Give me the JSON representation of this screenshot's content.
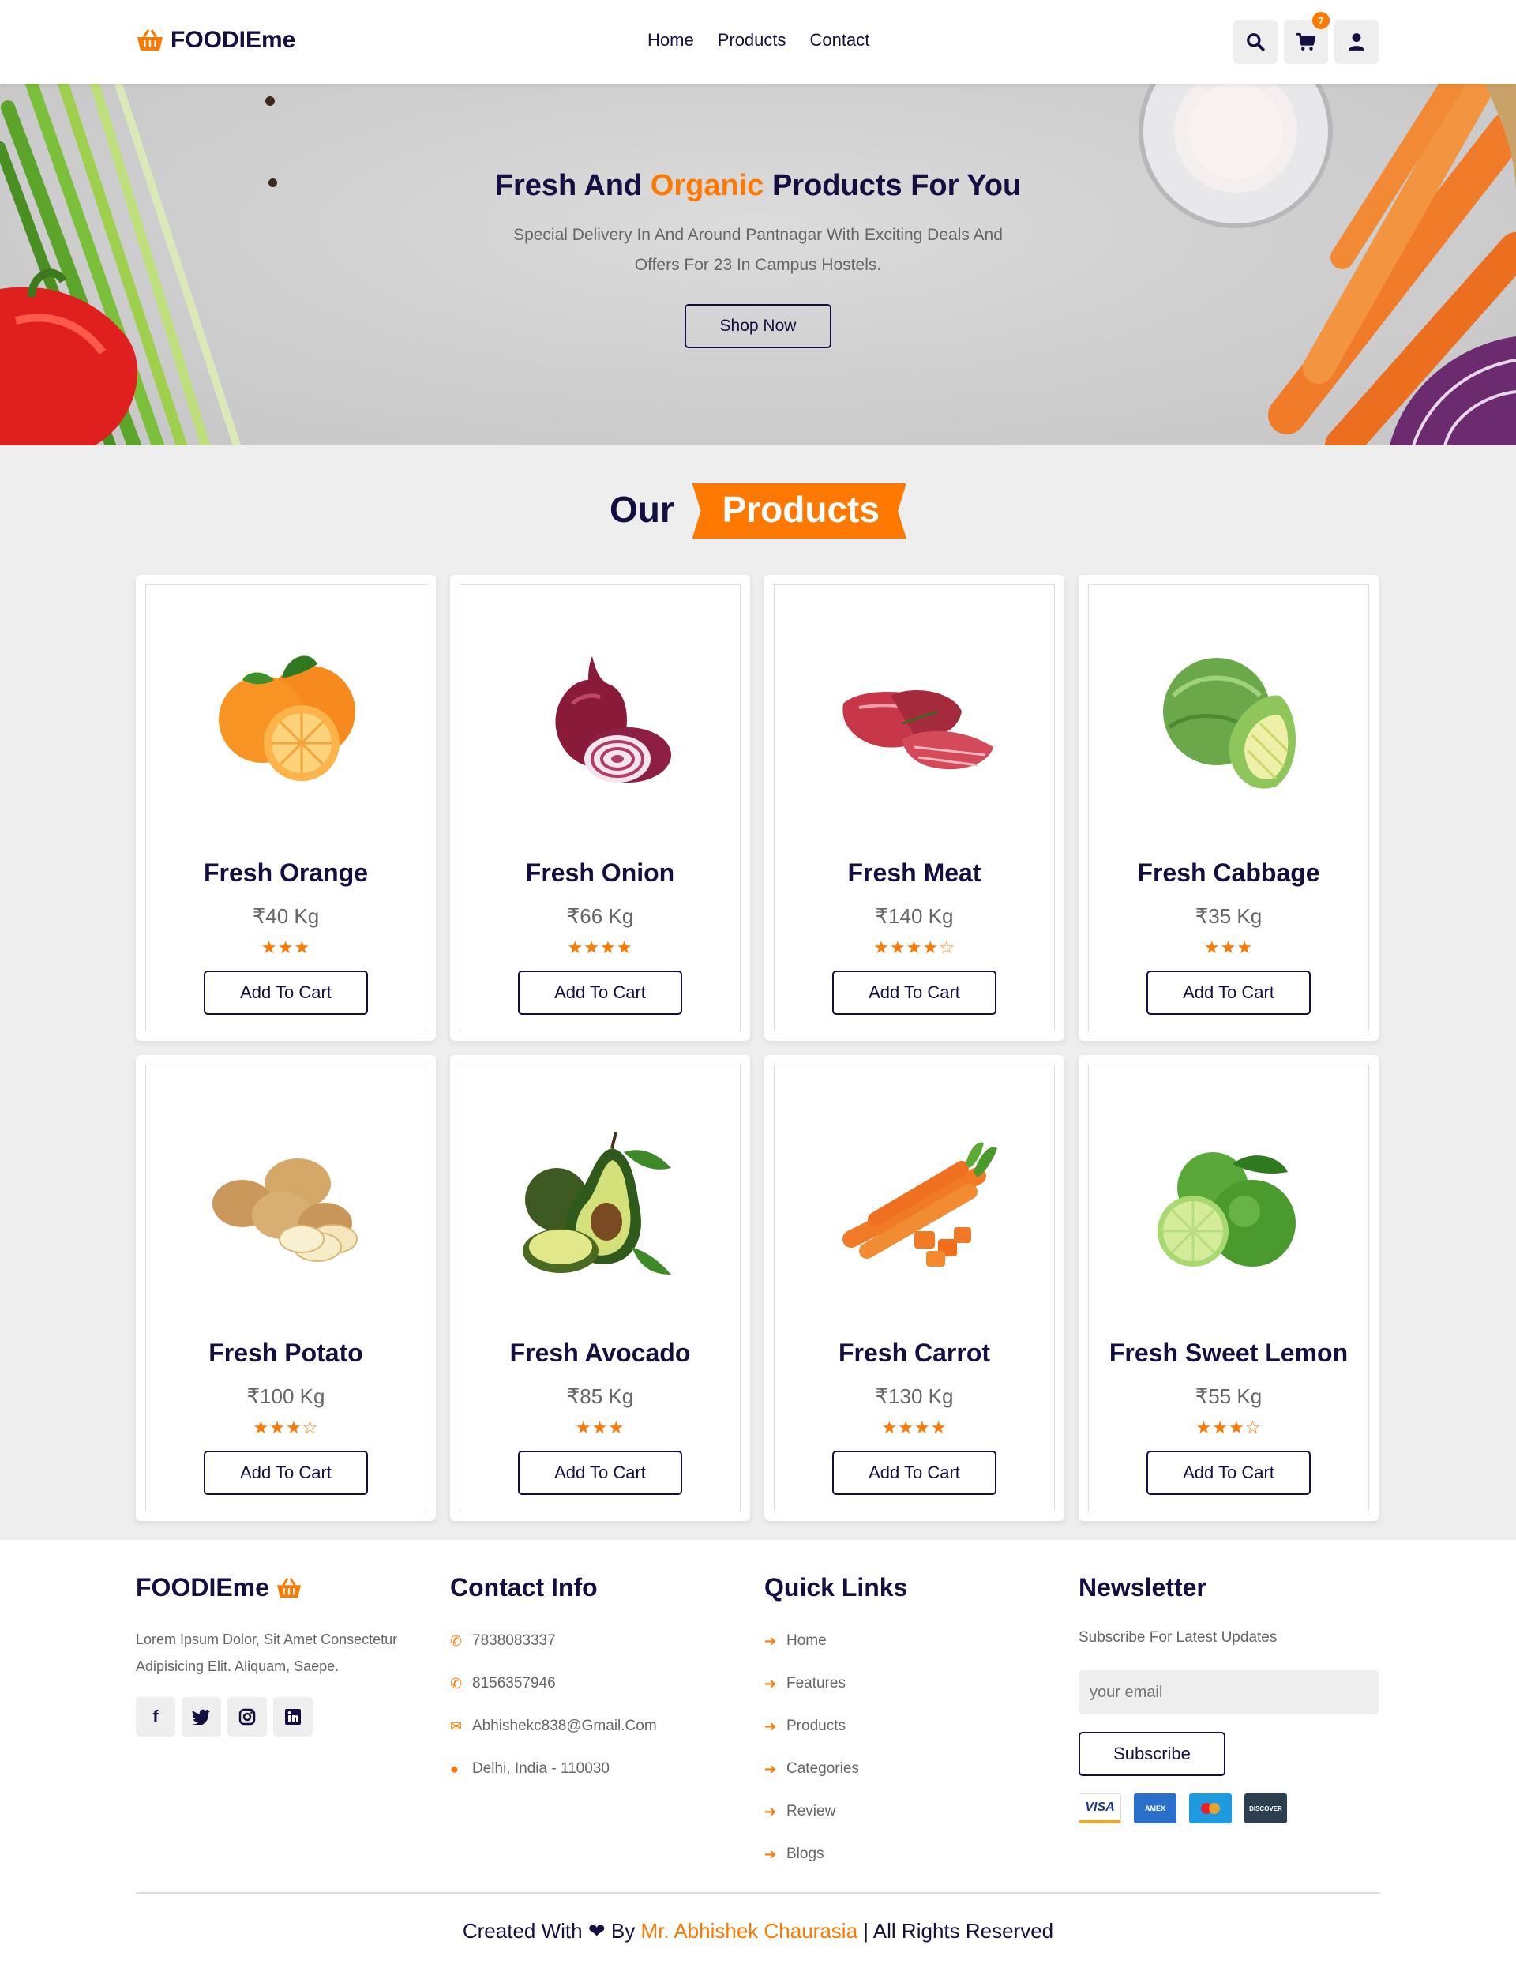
{
  "header": {
    "brand": "FOODIEme",
    "nav": [
      "Home",
      "Products",
      "Contact"
    ],
    "cart_count": "7",
    "icons": [
      "search-icon",
      "cart-icon",
      "user-icon"
    ]
  },
  "hero": {
    "title_before": "Fresh And ",
    "title_accent": "Organic",
    "title_after": " Products For You",
    "subtitle_line1": "Special Delivery In And Around Pantnagar With Exciting Deals And",
    "subtitle_line2": "Offers For 23 In Campus Hostels.",
    "cta": "Shop Now"
  },
  "products_section": {
    "title_plain": "Our",
    "title_ribbon": "Products"
  },
  "products": [
    {
      "name": "Fresh Orange",
      "price": "₹40 Kg",
      "stars": "★★★",
      "rating": 3,
      "button": "Add To Cart",
      "image": "orange"
    },
    {
      "name": "Fresh Onion",
      "price": "₹66 Kg",
      "stars": "★★★★",
      "rating": 4,
      "button": "Add To Cart",
      "image": "onion"
    },
    {
      "name": "Fresh Meat",
      "price": "₹140 Kg",
      "stars": "★★★★☆",
      "rating": 4.5,
      "button": "Add To Cart",
      "image": "meat"
    },
    {
      "name": "Fresh Cabbage",
      "price": "₹35 Kg",
      "stars": "★★★",
      "rating": 3,
      "button": "Add To Cart",
      "image": "cabbage"
    },
    {
      "name": "Fresh Potato",
      "price": "₹100 Kg",
      "stars": "★★★☆",
      "rating": 3.5,
      "button": "Add To Cart",
      "image": "potato"
    },
    {
      "name": "Fresh Avocado",
      "price": "₹85 Kg",
      "stars": "★★★",
      "rating": 3,
      "button": "Add To Cart",
      "image": "avocado"
    },
    {
      "name": "Fresh Carrot",
      "price": "₹130 Kg",
      "stars": "★★★★",
      "rating": 4,
      "button": "Add To Cart",
      "image": "carrot"
    },
    {
      "name": "Fresh Sweet Lemon",
      "price": "₹55 Kg",
      "stars": "★★★☆",
      "rating": 3.5,
      "button": "Add To Cart",
      "image": "lemon"
    }
  ],
  "footer": {
    "brand": "FOODIEme",
    "about": "Lorem Ipsum Dolor, Sit Amet Consectetur Adipisicing Elit. Aliquam, Saepe.",
    "socials": [
      "facebook-icon",
      "twitter-icon",
      "instagram-icon",
      "linkedin-icon"
    ],
    "contact_title": "Contact Info",
    "contacts": [
      {
        "icon": "phone-icon",
        "text": "7838083337"
      },
      {
        "icon": "phone-icon",
        "text": "8156357946"
      },
      {
        "icon": "envelope-icon",
        "text": "Abhishekc838@Gmail.Com"
      },
      {
        "icon": "map-marker-icon",
        "text": "Delhi, India - 110030"
      }
    ],
    "links_title": "Quick Links",
    "links": [
      "Home",
      "Features",
      "Products",
      "Categories",
      "Review",
      "Blogs"
    ],
    "newsletter_title": "Newsletter",
    "newsletter_text": "Subscribe For Latest Updates",
    "email_placeholder": "your email",
    "subscribe": "Subscribe",
    "payment_cards": [
      "VISA",
      "AMEX",
      "MAESTRO",
      "DISCOVER"
    ],
    "credit_before": "Created With",
    "credit_by": "By",
    "credit_name": "Mr. Abhishek Chaurasia",
    "credit_after": "| All Rights Reserved"
  },
  "colors": {
    "accent": "#ff7800",
    "dark": "#130f40",
    "light_bg": "#eeeeee"
  }
}
